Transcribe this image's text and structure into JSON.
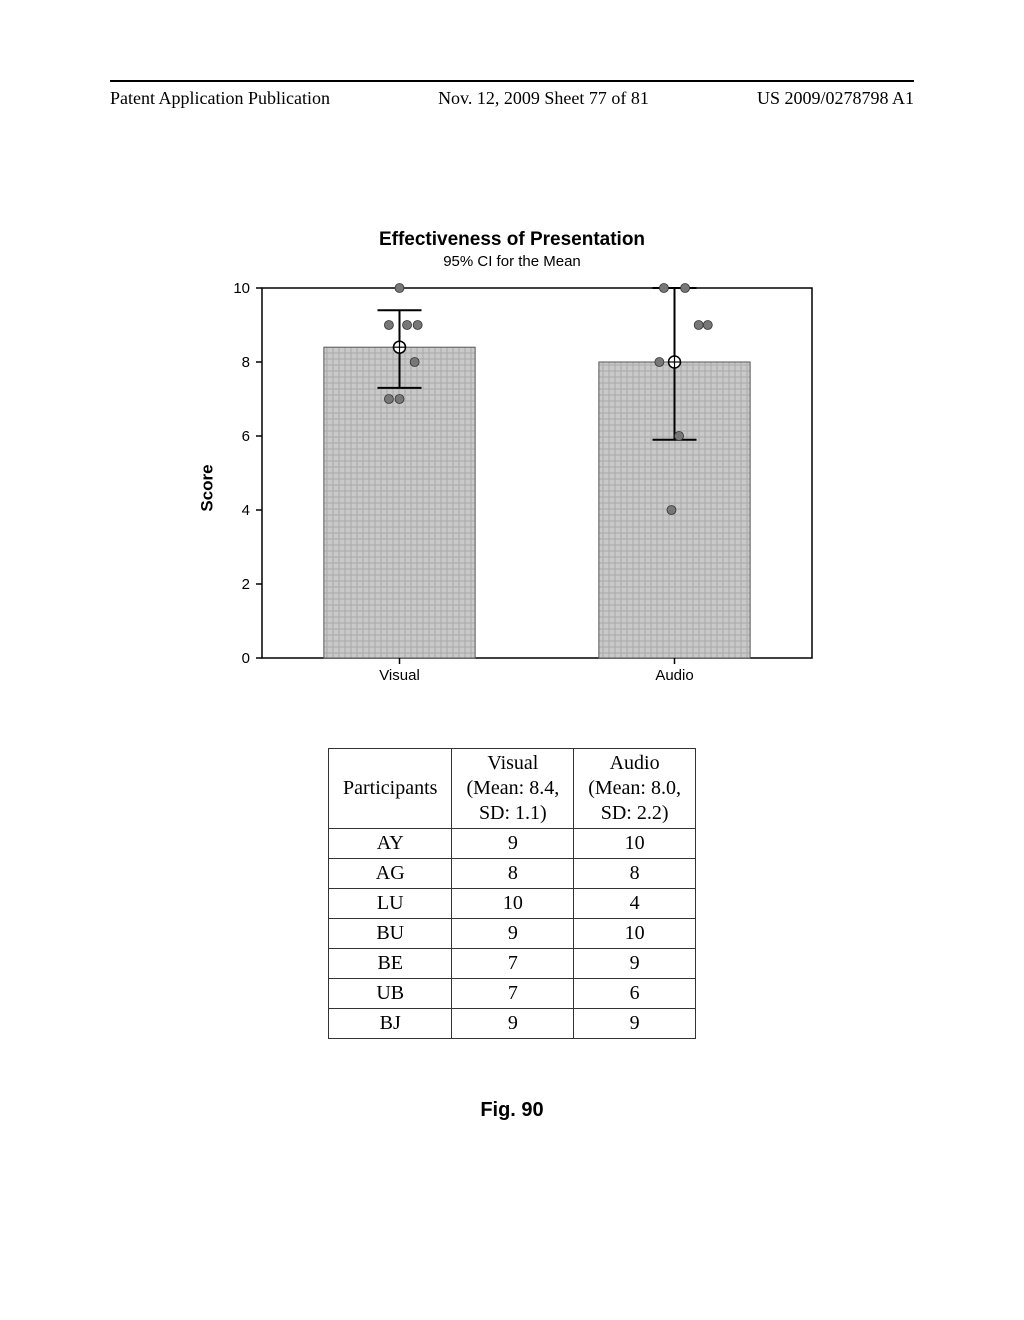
{
  "header": {
    "left": "Patent Application Publication",
    "middle": "Nov. 12, 2009  Sheet 77 of 81",
    "right": "US 2009/0278798 A1"
  },
  "chart_data": {
    "type": "bar",
    "title": "Effectiveness of Presentation",
    "subtitle": "95% CI for the Mean",
    "ylabel": "Score",
    "xlabel": "",
    "ylim": [
      0,
      10
    ],
    "yticks": [
      0,
      2,
      4,
      6,
      8,
      10
    ],
    "categories": [
      "Visual",
      "Audio"
    ],
    "values": [
      8.4,
      8.0
    ],
    "ci": [
      {
        "low": 7.3,
        "high": 9.4
      },
      {
        "low": 5.9,
        "high": 10.0
      }
    ],
    "jitter": {
      "Visual": [
        {
          "y": 10,
          "dx": 0.0
        },
        {
          "y": 9,
          "dx": -0.07
        },
        {
          "y": 9,
          "dx": 0.05
        },
        {
          "y": 9,
          "dx": 0.12
        },
        {
          "y": 8,
          "dx": 0.1
        },
        {
          "y": 7,
          "dx": -0.07
        },
        {
          "y": 7,
          "dx": 0.0
        }
      ],
      "Audio": [
        {
          "y": 10,
          "dx": -0.07
        },
        {
          "y": 10,
          "dx": 0.07
        },
        {
          "y": 9,
          "dx": 0.16
        },
        {
          "y": 9,
          "dx": 0.22
        },
        {
          "y": 8,
          "dx": -0.1
        },
        {
          "y": 6,
          "dx": 0.03
        },
        {
          "y": 4,
          "dx": -0.02
        }
      ]
    }
  },
  "table": {
    "headers": {
      "col1": "Participants",
      "col2_l1": "Visual",
      "col2_l2": "(Mean: 8.4,",
      "col2_l3": "SD: 1.1)",
      "col3_l1": "Audio",
      "col3_l2": "(Mean: 8.0,",
      "col3_l3": "SD: 2.2)"
    },
    "rows": [
      {
        "p": "AY",
        "v": "9",
        "a": "10"
      },
      {
        "p": "AG",
        "v": "8",
        "a": "8"
      },
      {
        "p": "LU",
        "v": "10",
        "a": "4"
      },
      {
        "p": "BU",
        "v": "9",
        "a": "10"
      },
      {
        "p": "BE",
        "v": "7",
        "a": "9"
      },
      {
        "p": "UB",
        "v": "7",
        "a": "6"
      },
      {
        "p": "BJ",
        "v": "9",
        "a": "9"
      }
    ]
  },
  "figure_caption": "Fig. 90"
}
